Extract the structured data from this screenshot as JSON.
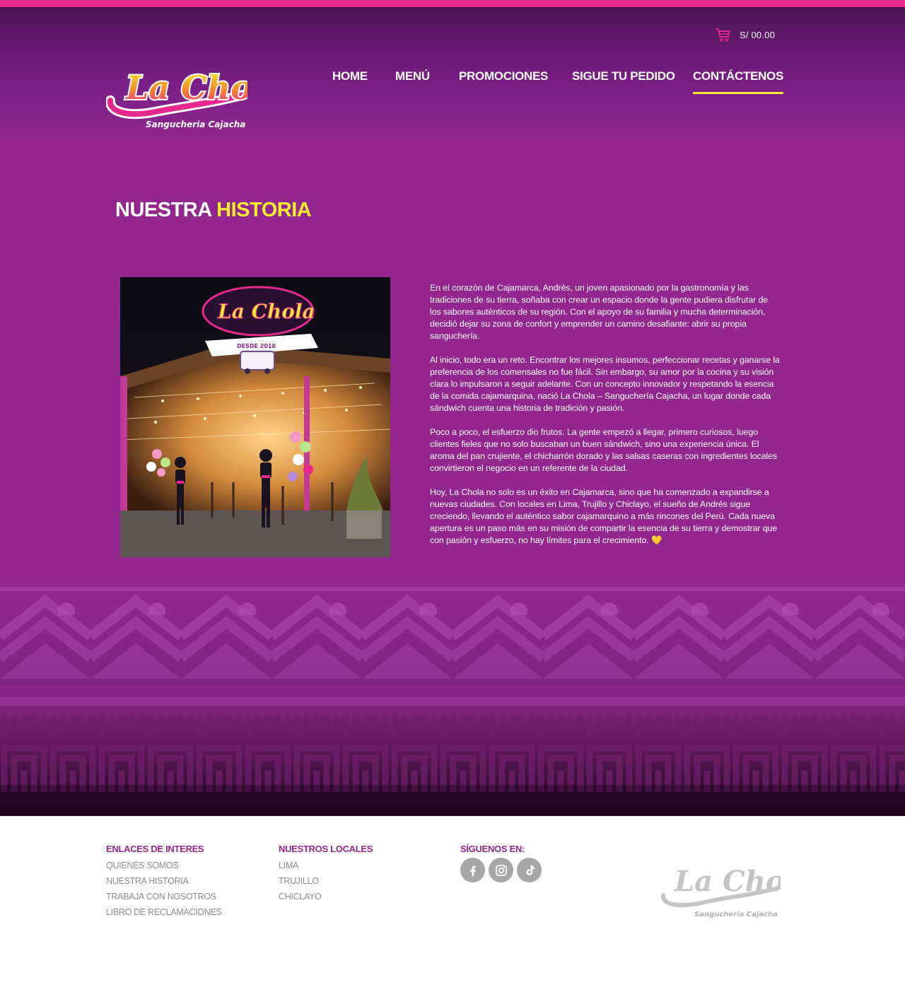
{
  "header": {
    "cart_total": "S/ 00.00",
    "logo": {
      "brand": "La Chola",
      "tagline": "Sangucheria Cajacha"
    }
  },
  "nav": {
    "items": [
      {
        "label": "HOME"
      },
      {
        "label": "MENÚ"
      },
      {
        "label": "PROMOCIONES"
      },
      {
        "label": "SIGUE TU PEDIDO"
      },
      {
        "label": "CONTÁCTENOS"
      }
    ],
    "active_index": 4
  },
  "page": {
    "title_part1": "NUESTRA",
    "title_part2": "HISTORIA"
  },
  "photo": {
    "sign_text": "La Chola",
    "sign_subtext": "DESDE 2018"
  },
  "story": {
    "paragraphs": [
      "En el corazón de Cajamarca, Andrés, un joven apasionado por la gastronomía y las tradiciones de su tierra, soñaba con crear un espacio donde la gente pudiera disfrutar de los sabores auténticos de su región. Con el apoyo de su familia y mucha determinación, decidió dejar su zona de confort y emprender un camino desafiante: abrir su propia sanguchería.",
      "Al inicio, todo era un reto. Encontrar los mejores insumos, perfeccionar recetas y ganarse la preferencia de los comensales no fue fácil. Sin embargo, su amor por la cocina y su visión clara lo impulsaron a seguir adelante. Con un concepto innovador y respetando la esencia de la comida cajamarquina, nació La Chola – Sanguchería Cajacha, un lugar donde cada sándwich cuenta una historia de tradición y pasión.",
      "Poco a poco, el esfuerzo dio frutos. La gente empezó a llegar, primero curiosos, luego clientes fieles que no solo buscaban un buen sándwich, sino una experiencia única. El aroma del pan crujiente, el chicharrón dorado y las salsas caseras con ingredientes locales convirtieron el negocio en un referente de la ciudad.",
      "Hoy, La Chola no solo es un éxito en Cajamarca, sino que ha comenzado a expandirse a nuevas ciudades. Con locales en Lima, Trujillo y Chiclayo, el sueño de Andrés sigue creciendo, llevando el auténtico sabor cajamarquino a más rincones del Perú. Cada nueva apertura es un paso más en su misión de compartir la esencia de su tierra y demostrar que con pasión y esfuerzo, no hay límites para el crecimiento. 💛"
    ]
  },
  "footer": {
    "links": {
      "heading": "ENLACES DE INTERES",
      "items": [
        "QUIENES SOMOS",
        "NUESTRA HISTORIA",
        "TRABAJA CON NOSOTROS",
        "LIBRO DE  RECLAMACIONES"
      ]
    },
    "locales": {
      "heading": "NUESTROS LOCALES",
      "items": [
        "LIMA",
        "TRUJILLO",
        "CHICLAYO"
      ]
    },
    "social": {
      "heading": "SÍGUENOS EN:",
      "icons": [
        "facebook-icon",
        "instagram-icon",
        "tiktok-icon"
      ]
    },
    "logo": {
      "brand": "La Chola",
      "tagline": "Sangucheria Cajacha"
    }
  },
  "colors": {
    "accent_pink": "#e7288f",
    "brand_purple": "#93278f",
    "highlight_yellow": "#f7ec2f",
    "footer_gray": "#8c8c8c"
  }
}
